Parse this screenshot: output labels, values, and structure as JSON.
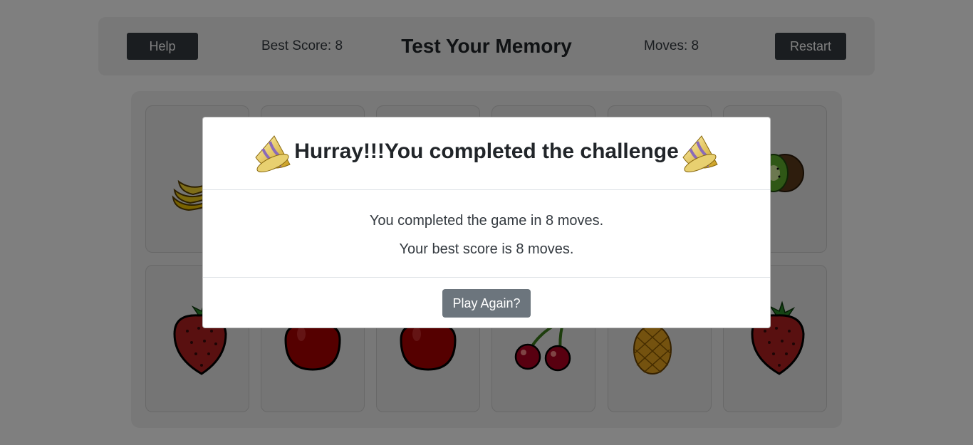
{
  "header": {
    "help_label": "Help",
    "best_score": "Best Score: 8",
    "title": "Test Your Memory",
    "moves": "Moves: 8",
    "restart_label": "Restart"
  },
  "board": {
    "cards": [
      {
        "fruit": "banana-icon"
      },
      {
        "fruit": "hidden"
      },
      {
        "fruit": "hidden"
      },
      {
        "fruit": "hidden"
      },
      {
        "fruit": "hidden"
      },
      {
        "fruit": "kiwi-icon"
      },
      {
        "fruit": "strawberry-icon"
      },
      {
        "fruit": "apple-icon"
      },
      {
        "fruit": "apple-icon"
      },
      {
        "fruit": "cherry-icon"
      },
      {
        "fruit": "pineapple-icon"
      },
      {
        "fruit": "strawberry-icon"
      }
    ]
  },
  "modal": {
    "title": "Hurray!!!You completed the challenge",
    "line1": "You completed the game in 8 moves.",
    "line2": "Your best score is 8 moves.",
    "play_again_label": "Play Again?",
    "icon": "party-popper-icon"
  },
  "colors": {
    "dark_button": "#343a40",
    "secondary_button": "#6c757d",
    "overlay": "rgba(0,0,0,0.5)"
  }
}
